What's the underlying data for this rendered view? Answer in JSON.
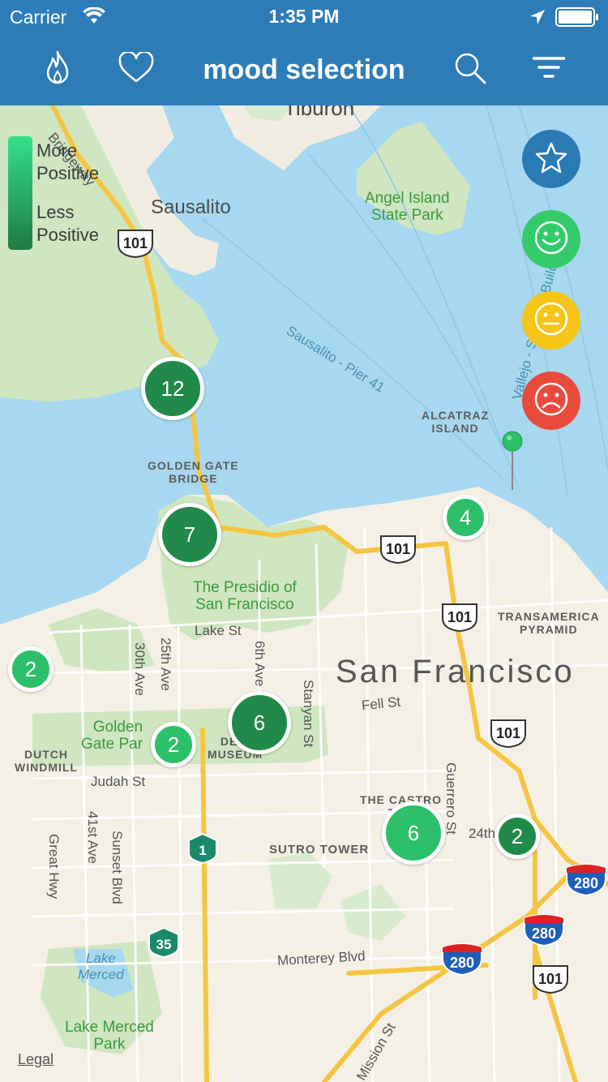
{
  "status_bar": {
    "carrier": "Carrier",
    "time": "1:35 PM"
  },
  "nav": {
    "title": "mood selection",
    "left_icons": [
      "flame-icon",
      "heart-icon"
    ],
    "right_icons": [
      "search-icon",
      "filter-icon"
    ]
  },
  "legend": {
    "top_label_1": "More",
    "top_label_2": "Positive",
    "bottom_label_1": "Less",
    "bottom_label_2": "Positive",
    "colors": [
      "#33e08a",
      "#1f7a44"
    ]
  },
  "mood_buttons": [
    {
      "name": "star",
      "icon": "star-icon",
      "color": "#2a7ab5"
    },
    {
      "name": "happy",
      "icon": "happy-face-icon",
      "color": "#34cc6b"
    },
    {
      "name": "neutral",
      "icon": "neutral-face-icon",
      "color": "#f5c518"
    },
    {
      "name": "sad",
      "icon": "sad-face-icon",
      "color": "#e84b3c"
    }
  ],
  "clusters": [
    {
      "count": "12",
      "tone": "dark"
    },
    {
      "count": "7",
      "tone": "dark"
    },
    {
      "count": "4",
      "tone": "light"
    },
    {
      "count": "2",
      "tone": "light"
    },
    {
      "count": "2",
      "tone": "light"
    },
    {
      "count": "6",
      "tone": "dark"
    },
    {
      "count": "6",
      "tone": "light"
    },
    {
      "count": "2",
      "tone": "dark"
    }
  ],
  "map_labels": {
    "tiburon": "Tiburon",
    "sausalito": "Sausalito",
    "angel_island_1": "Angel Island",
    "angel_island_2": "State Park",
    "ferry_route": "Sausalito - Pier 41",
    "vallejo_ferry": "Vallejo - SF Ferry Building",
    "bridgeway": "Bridgeway",
    "alcatraz_1": "ALCATRAZ",
    "alcatraz_2": "ISLAND",
    "golden_gate_1": "GOLDEN GATE",
    "golden_gate_2": "BRIDGE",
    "presidio_1": "The Presidio of",
    "presidio_2": "San Francisco",
    "transamerica_1": "TRANSAMERICA",
    "transamerica_2": "PYRAMID",
    "san_francisco": "San Francisco",
    "lake_st": "Lake St",
    "fell_st": "Fell St",
    "judah_st": "Judah St",
    "ave_30": "30th Ave",
    "ave_25": "25th Ave",
    "ave_6": "6th Ave",
    "stanyan": "Stanyan St",
    "golden_gate_park_1": "Golden",
    "golden_gate_park_2": "Gate Par",
    "de_young_1": "DE Y",
    "de_young_2": "MUSEUM",
    "dutch_windmill_1": "DUTCH",
    "dutch_windmill_2": "WINDMILL",
    "castro_1": "THE CASTRO",
    "castro_2": "THE",
    "guerrero": "Guerrero St",
    "st_24": "24th",
    "sutro": "SUTRO TOWER",
    "ave_41": "41st Ave",
    "sunset": "Sunset Blvd",
    "great_hwy": "Great Hwy",
    "monterey": "Monterey Blvd",
    "lake_merced_water_1": "Lake",
    "lake_merced_water_2": "Merced",
    "lake_merced_park_1": "Lake Merced",
    "lake_merced_park_2": "Park",
    "mission": "Mission St",
    "legal": "Legal"
  },
  "route_shields": {
    "us101": "101",
    "i280": "280",
    "ca1": "1",
    "ca35": "35"
  }
}
